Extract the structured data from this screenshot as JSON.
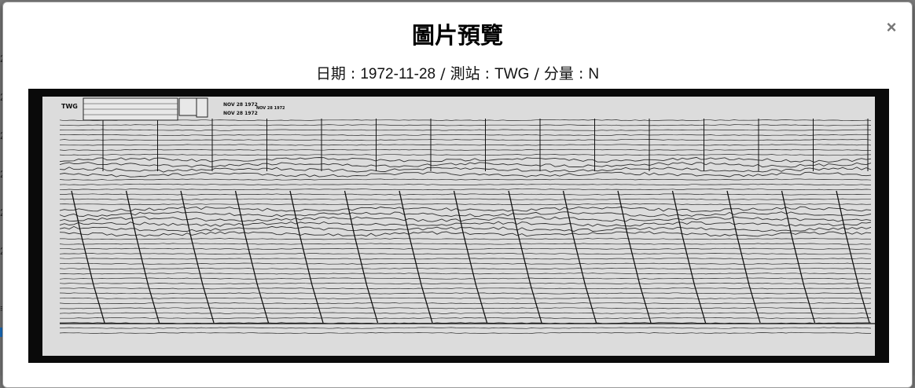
{
  "modal": {
    "title": "圖片預覽",
    "close_label": "×",
    "meta": {
      "date_label": "日期",
      "date_value": "1972-11-28",
      "station_label": "測站",
      "station_value": "TWG",
      "component_label": "分量",
      "component_value": "N",
      "separator": " / ",
      "colon": " : "
    }
  },
  "seismogram": {
    "station_mark": "TWG",
    "stamp_1": "NOV 28 1972",
    "stamp_2": "NOV 28 1972",
    "stamp_3": "NOV 28 1972"
  },
  "background": {
    "row_glyph": "2",
    "menu_glyph": "≡"
  },
  "colors": {
    "overlay": "#7a7a7a",
    "modal_bg": "#ffffff",
    "preview_frame": "#0a0a0a",
    "paper": "#dedede",
    "trace": "#111111",
    "accent": "#1a73c7"
  }
}
